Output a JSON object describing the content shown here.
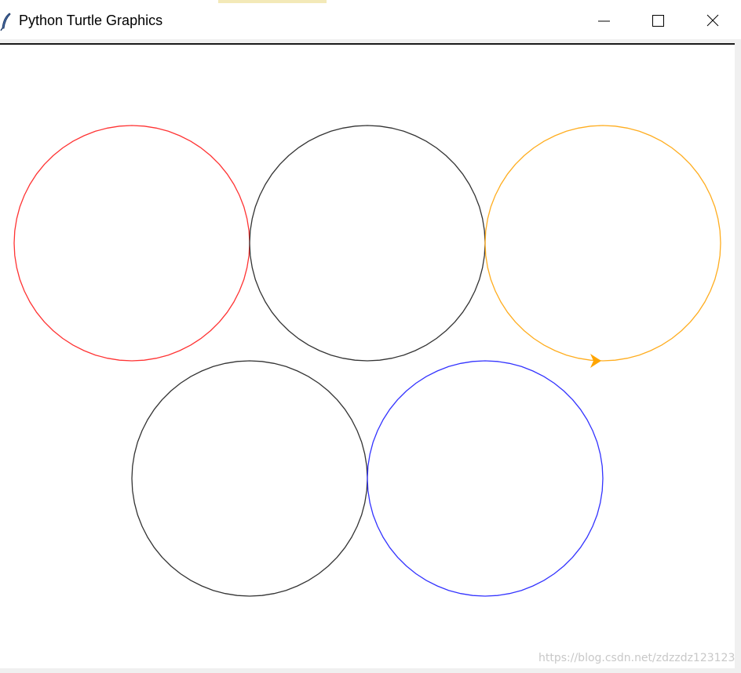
{
  "window": {
    "title": "Python Turtle Graphics"
  },
  "icons": {
    "app": "feather-icon",
    "minimize": "minimize-icon",
    "maximize": "maximize-icon",
    "close": "close-icon"
  },
  "drawing": {
    "circles": [
      {
        "name": "red-circle",
        "color": "#ff3333"
      },
      {
        "name": "black-circle-top",
        "color": "#333333"
      },
      {
        "name": "orange-circle",
        "color": "#ffad1f"
      },
      {
        "name": "black-circle-bottom",
        "color": "#333333"
      },
      {
        "name": "blue-circle",
        "color": "#3333ff"
      }
    ],
    "turtle_color": "#ffa500"
  },
  "watermark": "https://blog.csdn.net/zdzzdz123123"
}
